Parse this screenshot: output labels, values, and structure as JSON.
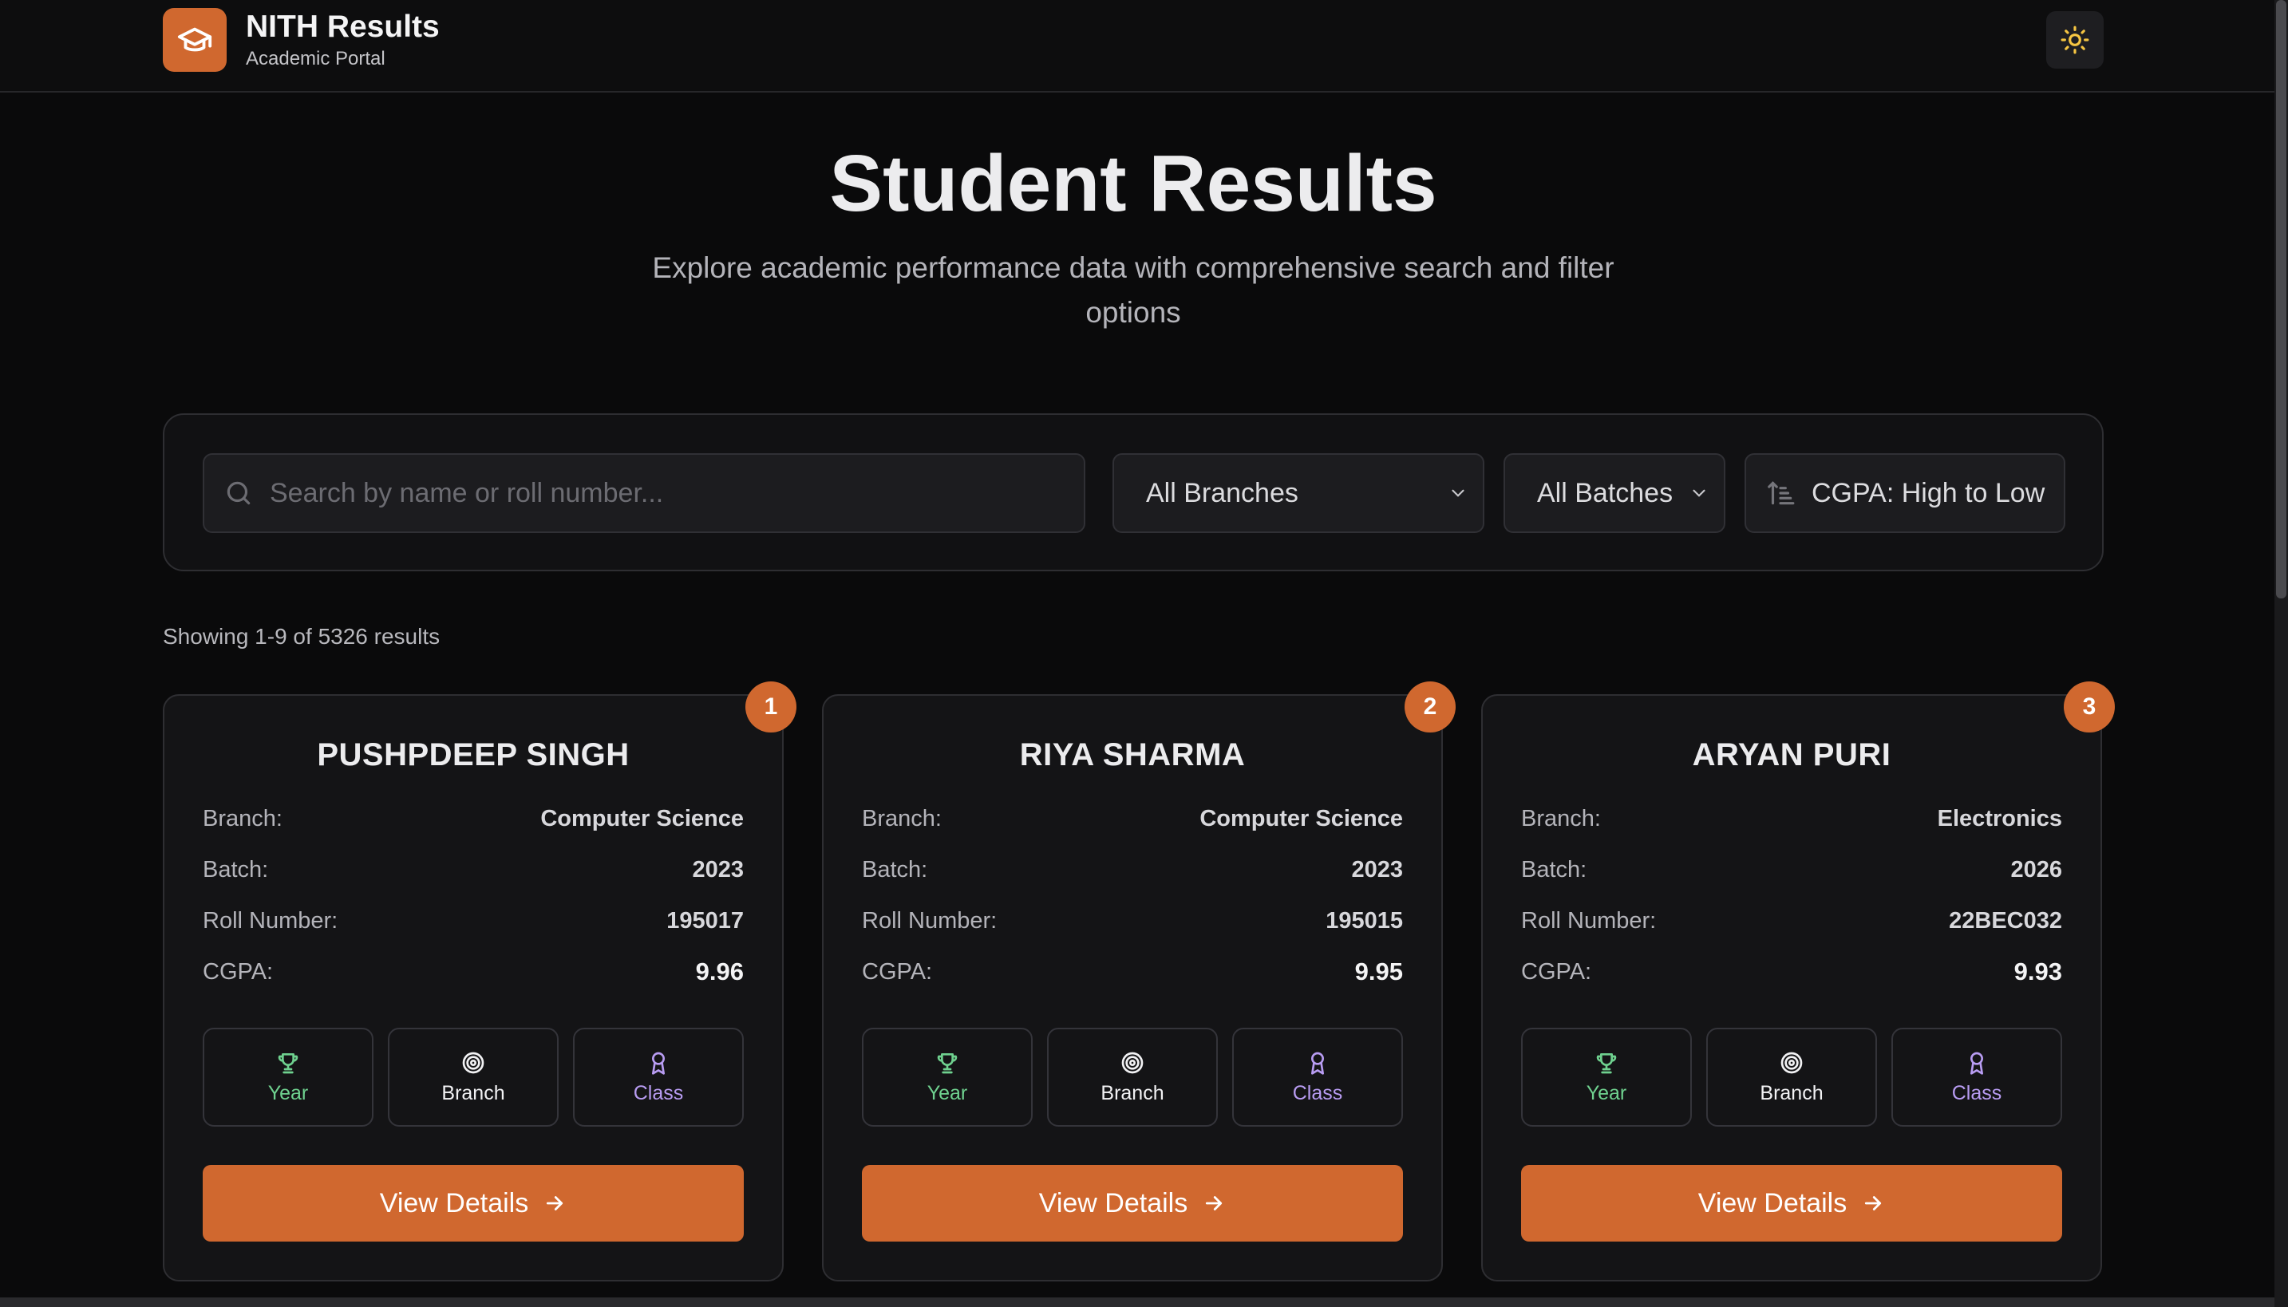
{
  "app": {
    "title": "NITH Results",
    "subtitle": "Academic Portal",
    "logo_icon": "graduation-cap-icon",
    "theme_icon": "sun-icon",
    "accent": "#d0682f"
  },
  "hero": {
    "title": "Student Results",
    "subtitle": "Explore academic performance data with comprehensive search and filter options"
  },
  "filters": {
    "search_placeholder": "Search by name or roll number...",
    "search_value": "",
    "branch_selected": "All Branches",
    "batch_selected": "All Batches",
    "sort_label": "CGPA: High to Low"
  },
  "results_count": "Showing 1-9 of 5326 results",
  "labels": {
    "branch": "Branch:",
    "batch": "Batch:",
    "roll": "Roll Number:",
    "cgpa": "CGPA:",
    "badge_year": "Year",
    "badge_branch": "Branch",
    "badge_class": "Class",
    "view_details": "View Details"
  },
  "students": [
    {
      "rank": "1",
      "name": "PUSHPDEEP SINGH",
      "branch": "Computer Science",
      "batch": "2023",
      "roll": "195017",
      "cgpa": "9.96"
    },
    {
      "rank": "2",
      "name": "RIYA SHARMA",
      "branch": "Computer Science",
      "batch": "2023",
      "roll": "195015",
      "cgpa": "9.95"
    },
    {
      "rank": "3",
      "name": "ARYAN PURI",
      "branch": "Electronics",
      "batch": "2026",
      "roll": "22BEC032",
      "cgpa": "9.93"
    }
  ]
}
